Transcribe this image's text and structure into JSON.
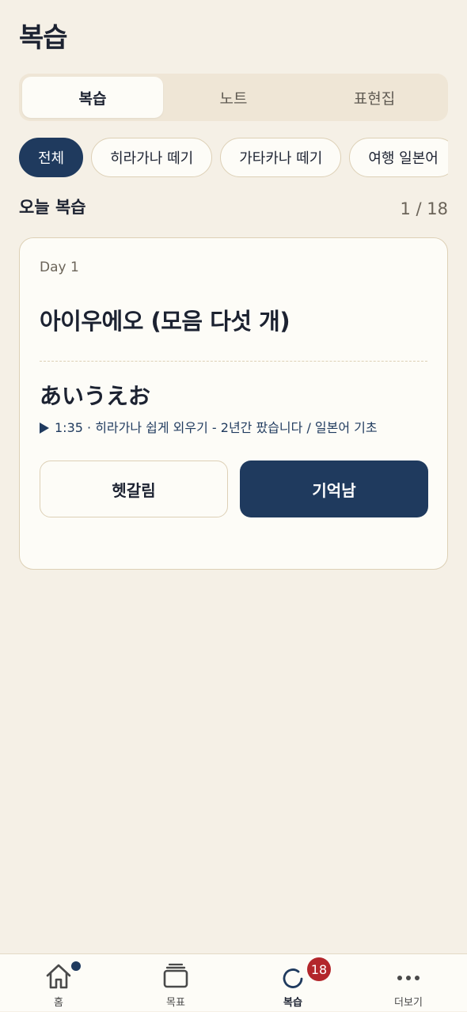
{
  "header": {
    "title": "복습"
  },
  "segment_tabs": [
    {
      "label": "복습",
      "active": true
    },
    {
      "label": "노트",
      "active": false
    },
    {
      "label": "표현집",
      "active": false
    }
  ],
  "filter_chips": [
    {
      "label": "전체",
      "active": true
    },
    {
      "label": "히라가나 떼기",
      "active": false
    },
    {
      "label": "가타카나 떼기",
      "active": false
    },
    {
      "label": "여행 일본어",
      "active": false
    }
  ],
  "section": {
    "title": "오늘 복습",
    "counter": "1 / 18"
  },
  "card": {
    "day": "Day 1",
    "title": "아이우에오 (모음 다섯 개)",
    "kana": "あいうえお",
    "play_icon": "play-icon",
    "source": "1:35 · 히라가나 쉽게 외우기 - 2년간 팠습니다 / 일본어 기초",
    "unsure_label": "헷갈림",
    "remember_label": "기억남"
  },
  "bottom_nav": {
    "items": [
      {
        "label": "홈",
        "icon": "home-icon",
        "active": false
      },
      {
        "label": "목표",
        "icon": "stack-icon",
        "active": false
      },
      {
        "label": "복습",
        "icon": "refresh-icon",
        "active": true
      },
      {
        "label": "더보기",
        "icon": "more-icon",
        "active": false
      }
    ],
    "review_badge": "18"
  },
  "colors": {
    "background": "#f5f0e6",
    "primary": "#1f3a5e",
    "badge": "#b3262b",
    "card": "#fdfcf7",
    "border": "#ddd0b6"
  }
}
